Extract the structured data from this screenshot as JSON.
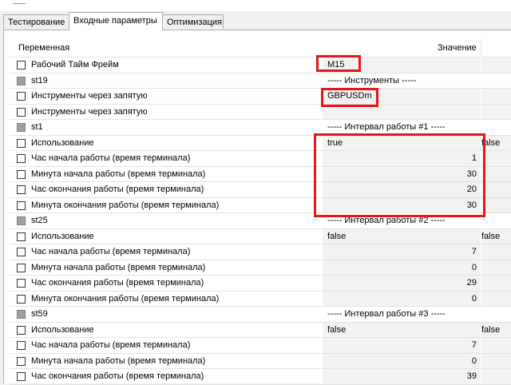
{
  "tabs": [
    {
      "label": "Тестирование"
    },
    {
      "label": "Входные параметры"
    },
    {
      "label": "Оптимизация"
    }
  ],
  "header": {
    "variable": "Переменная",
    "value": "Значение"
  },
  "rows": [
    {
      "kind": "param",
      "label": "Рабочий Тайм Фрейм",
      "value": "M15",
      "align": "text"
    },
    {
      "kind": "sep",
      "label": "st19",
      "value": "----- Инструменты -----"
    },
    {
      "kind": "param",
      "label": "Инструменты через запятую",
      "value": "GBPUSDm",
      "align": "text"
    },
    {
      "kind": "param",
      "label": "Инструменты через запятую",
      "value": "",
      "align": "text"
    },
    {
      "kind": "sep",
      "label": "st1",
      "value": "----- Интервал работы #1 -----"
    },
    {
      "kind": "param",
      "label": "Использование",
      "value": "true",
      "align": "text",
      "extra": "false"
    },
    {
      "kind": "param",
      "label": "Час начала работы (время терминала)",
      "value": "1",
      "align": "num"
    },
    {
      "kind": "param",
      "label": "Минута начала работы (время терминала)",
      "value": "30",
      "align": "num"
    },
    {
      "kind": "param",
      "label": "Час окончания работы (время терминала)",
      "value": "20",
      "align": "num"
    },
    {
      "kind": "param",
      "label": "Минута окончания работы (время терминала)",
      "value": "30",
      "align": "num"
    },
    {
      "kind": "sep",
      "label": "st25",
      "value": "----- Интервал работы #2 -----"
    },
    {
      "kind": "param",
      "label": "Использование",
      "value": "false",
      "align": "text",
      "extra": "false"
    },
    {
      "kind": "param",
      "label": "Час начала работы (время терминала)",
      "value": "7",
      "align": "num"
    },
    {
      "kind": "param",
      "label": "Минута начала работы (время терминала)",
      "value": "0",
      "align": "num"
    },
    {
      "kind": "param",
      "label": "Час окончания работы (время терминала)",
      "value": "29",
      "align": "num"
    },
    {
      "kind": "param",
      "label": "Минута окончания работы (время терминала)",
      "value": "0",
      "align": "num"
    },
    {
      "kind": "sep",
      "label": "st59",
      "value": "----- Интервал работы #3 -----"
    },
    {
      "kind": "param",
      "label": "Использование",
      "value": "false",
      "align": "text",
      "extra": "false"
    },
    {
      "kind": "param",
      "label": "Час начала работы (время терминала)",
      "value": "7",
      "align": "num"
    },
    {
      "kind": "param",
      "label": "Минута начала работы (время терминала)",
      "value": "0",
      "align": "num"
    },
    {
      "kind": "param",
      "label": "Час окончания работы (время терминала)",
      "value": "39",
      "align": "num"
    }
  ],
  "colors": {
    "highlight": "#e8141b",
    "value_bg": "#f2f2f2"
  }
}
